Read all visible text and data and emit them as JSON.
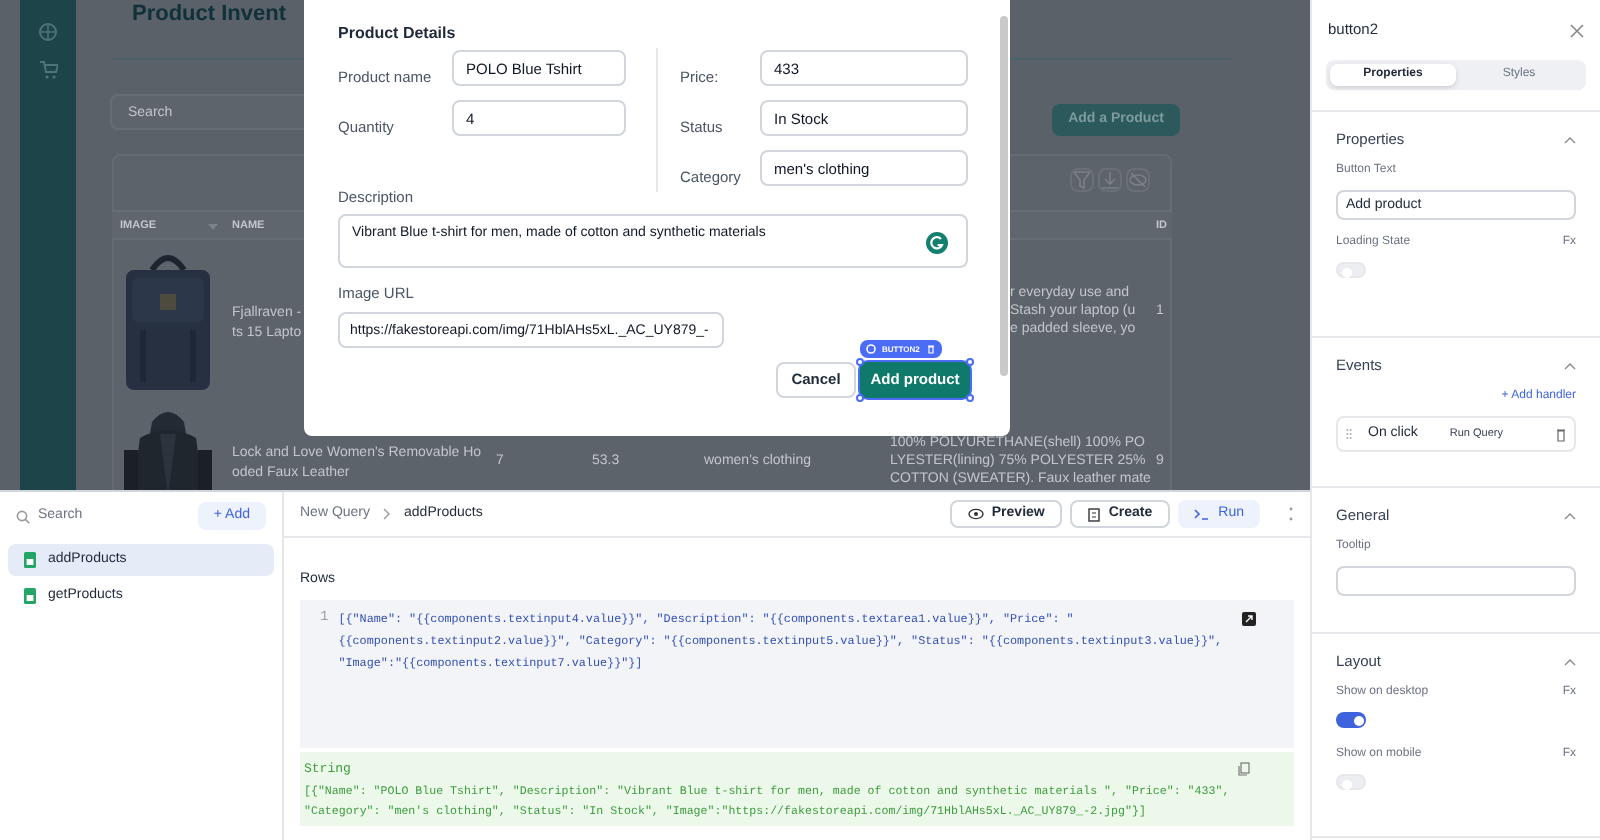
{
  "canvas": {
    "title": "Product Invent",
    "search": {
      "placeholder": "Search"
    },
    "add_button": "Add a Product",
    "table": {
      "columns": [
        "IMAGE",
        "NAME",
        "ID"
      ],
      "rows": [
        {
          "image": {
            "kind": "picture"
          },
          "name_lines": [
            "Fjallraven -",
            "ts 15 Lapto"
          ],
          "description_lines": [
            "r everyday use and",
            "Stash your laptop (u",
            "e padded sleeve, yo"
          ],
          "id": "1"
        },
        {
          "image": {
            "kind": "picture"
          },
          "name_lines": [
            "Lock and Love Women's Removable Ho",
            "oded Faux Leather"
          ],
          "column_3": "7",
          "column_4": "53.3",
          "column_5": "women's clothing",
          "description_lines": [
            "100% POLYURETHANE(shell) 100% PO",
            "LYESTER(lining) 75% POLYESTER 25%",
            "COTTON (SWEATER). Faux leather mate"
          ],
          "id": "9"
        }
      ]
    }
  },
  "modal": {
    "title": "Product Details",
    "left_fields": [
      {
        "label": "Product name",
        "value": "POLO Blue Tshirt"
      },
      {
        "label": "Quantity",
        "value": "4"
      }
    ],
    "right_fields": [
      {
        "label": "Price:",
        "value": "433"
      },
      {
        "label": "Status",
        "value": "In Stock"
      },
      {
        "label": "Category",
        "value": "men's clothing"
      }
    ],
    "description": {
      "label": "Description",
      "value": "Vibrant Blue t-shirt for men, made of cotton and synthetic materials"
    },
    "image_url": {
      "label": "Image URL",
      "value": "https://fakestoreapi.com/img/71HblAHs5xL._AC_UY879_-"
    },
    "cancel_button": "Cancel",
    "add_button": {
      "label": "Add product",
      "selected": true,
      "tag": "BUTTON2"
    }
  },
  "query_list": {
    "search": {
      "placeholder": "Search"
    },
    "add_button": "+ Add",
    "items": [
      {
        "name": "addProducts",
        "selected": true
      },
      {
        "name": "getProducts",
        "selected": false
      }
    ]
  },
  "query_editor": {
    "breadcrumb": [
      "New Query",
      "addProducts"
    ],
    "buttons": [
      {
        "kind": "preview",
        "label": "Preview"
      },
      {
        "kind": "create",
        "label": "Create"
      },
      {
        "kind": "run",
        "label": "Run"
      }
    ],
    "rows_label": "Rows",
    "line_number": "1",
    "code_lines": [
      "[{\"Name\": \"{{components.textinput4.value}}\", \"Description\": \"{{components.textarea1.value}}\", \"Price\": \"",
      "{{components.textinput2.value}}\", \"Category\": \"{{components.textinput5.value}}\", \"Status\": \"{{components.textinput3.value}}\",",
      "\"Image\":\"{{components.textinput7.value}}\"}]"
    ],
    "result": {
      "type": "String",
      "lines": [
        "[{\"Name\": \"POLO Blue Tshirt\", \"Description\": \"Vibrant Blue t-shirt for men, made of cotton and synthetic materials \", \"Price\": \"433\",",
        "\"Category\": \"men's clothing\", \"Status\": \"In Stock\", \"Image\":\"https://fakestoreapi.com/img/71HblAHs5xL._AC_UY879_-2.jpg\"}]"
      ]
    }
  },
  "inspector": {
    "title": "button2",
    "tabs": [
      {
        "label": "Properties",
        "selected": true
      },
      {
        "label": "Styles",
        "selected": false
      }
    ],
    "sections": [
      {
        "title": "Properties",
        "expanded": true,
        "items": [
          {
            "kind": "label",
            "text": "Button Text"
          },
          {
            "kind": "input",
            "value": "Add product"
          },
          {
            "kind": "label",
            "text": "Loading State",
            "fx": "Fx"
          },
          {
            "kind": "toggle",
            "on": false
          }
        ]
      },
      {
        "title": "Events",
        "expanded": true,
        "items": [
          {
            "kind": "link",
            "text": "+ Add handler"
          },
          {
            "kind": "handler",
            "event": "On click",
            "action": "Run Query"
          }
        ]
      },
      {
        "title": "General",
        "expanded": true,
        "items": [
          {
            "kind": "label",
            "text": "Tooltip"
          },
          {
            "kind": "input"
          }
        ]
      },
      {
        "title": "Layout",
        "expanded": true,
        "items": [
          {
            "kind": "label",
            "text": "Show on desktop",
            "fx": "Fx"
          },
          {
            "kind": "toggle",
            "on": true
          },
          {
            "kind": "label",
            "text": "Show on mobile",
            "fx": "Fx"
          },
          {
            "kind": "toggle",
            "on": false
          }
        ]
      }
    ]
  }
}
